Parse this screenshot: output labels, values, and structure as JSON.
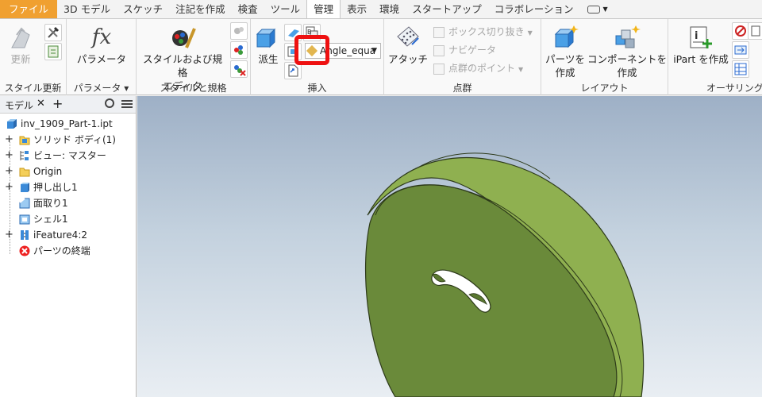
{
  "tabs": [
    "ファイル",
    "3D モデル",
    "スケッチ",
    "注記を作成",
    "検査",
    "ツール",
    "管理",
    "表示",
    "環境",
    "スタートアップ",
    "コラボレーション"
  ],
  "ribbon": {
    "style_update": {
      "button": "更新",
      "title": "スタイル更新"
    },
    "parameters": {
      "button": "パラメータ",
      "title": "パラメータ ▾"
    },
    "styles": {
      "button_line1": "スタイルおよび規格",
      "button_line2": "エディタ",
      "title": "スタイルと規格"
    },
    "insert": {
      "derive": "派生",
      "dropdown_value": "Angle_equa",
      "title": "挿入"
    },
    "point_cloud": {
      "attach": "アタッチ",
      "box_crop": "ボックス切り抜き",
      "navigator": "ナビゲータ",
      "points": "点群のポイント",
      "title": "点群"
    },
    "layout": {
      "make_part_1": "パーツを",
      "make_part_2": "作成",
      "make_component_1": "コンポーネントを",
      "make_component_2": "作成",
      "title": "レイアウト"
    },
    "authoring": {
      "ipart": "iPart を作成",
      "title": "オーサリング"
    }
  },
  "browser": {
    "tab": "モデル",
    "items": [
      {
        "label": "inv_1909_Part-1.ipt"
      },
      {
        "label": "ソリッド ボディ(1)"
      },
      {
        "label": "ビュー: マスター"
      },
      {
        "label": "Origin"
      },
      {
        "label": "押し出し1"
      },
      {
        "label": "面取り1"
      },
      {
        "label": "シェル1"
      },
      {
        "label": "iFeature4:2"
      },
      {
        "label": "パーツの終端"
      }
    ]
  },
  "colors": {
    "file_tab": "#f0a030",
    "highlight": "#ee1111",
    "model_face": "#6a8a3a",
    "model_rim": "#8fb050"
  }
}
